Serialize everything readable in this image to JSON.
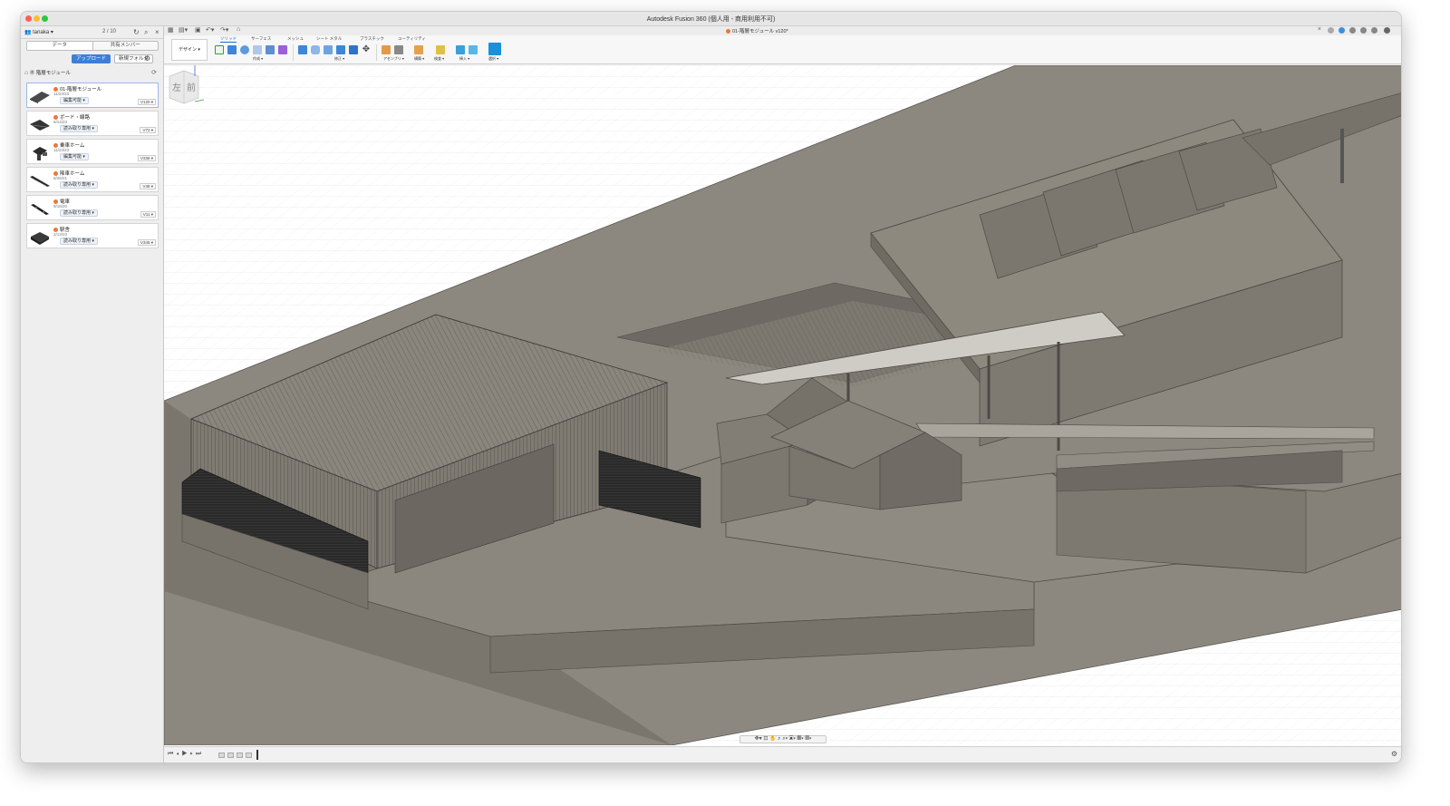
{
  "window": {
    "title": "Autodesk Fusion 360 (個人用 - 商用利用不可)"
  },
  "sidebar": {
    "user": "tanaka",
    "count": "2 / 10",
    "tabs": [
      "データ",
      "共有メンバー"
    ],
    "upload_label": "アップロード",
    "new_folder_label": "新規フォルダ",
    "breadcrumb": "㊍ 階層モジュール",
    "files": [
      {
        "name": "01-階層モジュール",
        "date": "11/23/23",
        "status": "編集可能",
        "version": "V120"
      },
      {
        "name": "ボード・線路",
        "date": "8/14/23",
        "status": "読み取り専用",
        "version": "V72"
      },
      {
        "name": "乗車ホーム",
        "date": "11/23/23",
        "status": "編集可能",
        "version": "V336"
      },
      {
        "name": "降車ホーム",
        "date": "6/26/21",
        "status": "読み取り専用",
        "version": "V48"
      },
      {
        "name": "電車",
        "date": "9/16/20",
        "status": "読み取り専用",
        "version": "V11"
      },
      {
        "name": "駅舎",
        "date": "2/13/23",
        "status": "読み取り専用",
        "version": "V346"
      }
    ]
  },
  "document": {
    "tab_title": "01-階層モジュール v120*"
  },
  "ribbon": {
    "workspace": "デザイン ▾",
    "tabs": [
      "ソリッド",
      "サーフェス",
      "メッシュ",
      "シート メタル",
      "プラスチック",
      "ユーティリティ"
    ],
    "groups": [
      "作成 ▾",
      "修正 ▾",
      "アセンブリ ▾",
      "構築 ▾",
      "検査 ▾",
      "挿入 ▾",
      "選択 ▾"
    ]
  },
  "viewcube": {
    "left": "左",
    "front": "前"
  },
  "colors": {
    "accent": "#1a6fd1",
    "upload": "#3d7fd5",
    "model": "#8f8b82",
    "model_dark": "#6f6b63"
  }
}
